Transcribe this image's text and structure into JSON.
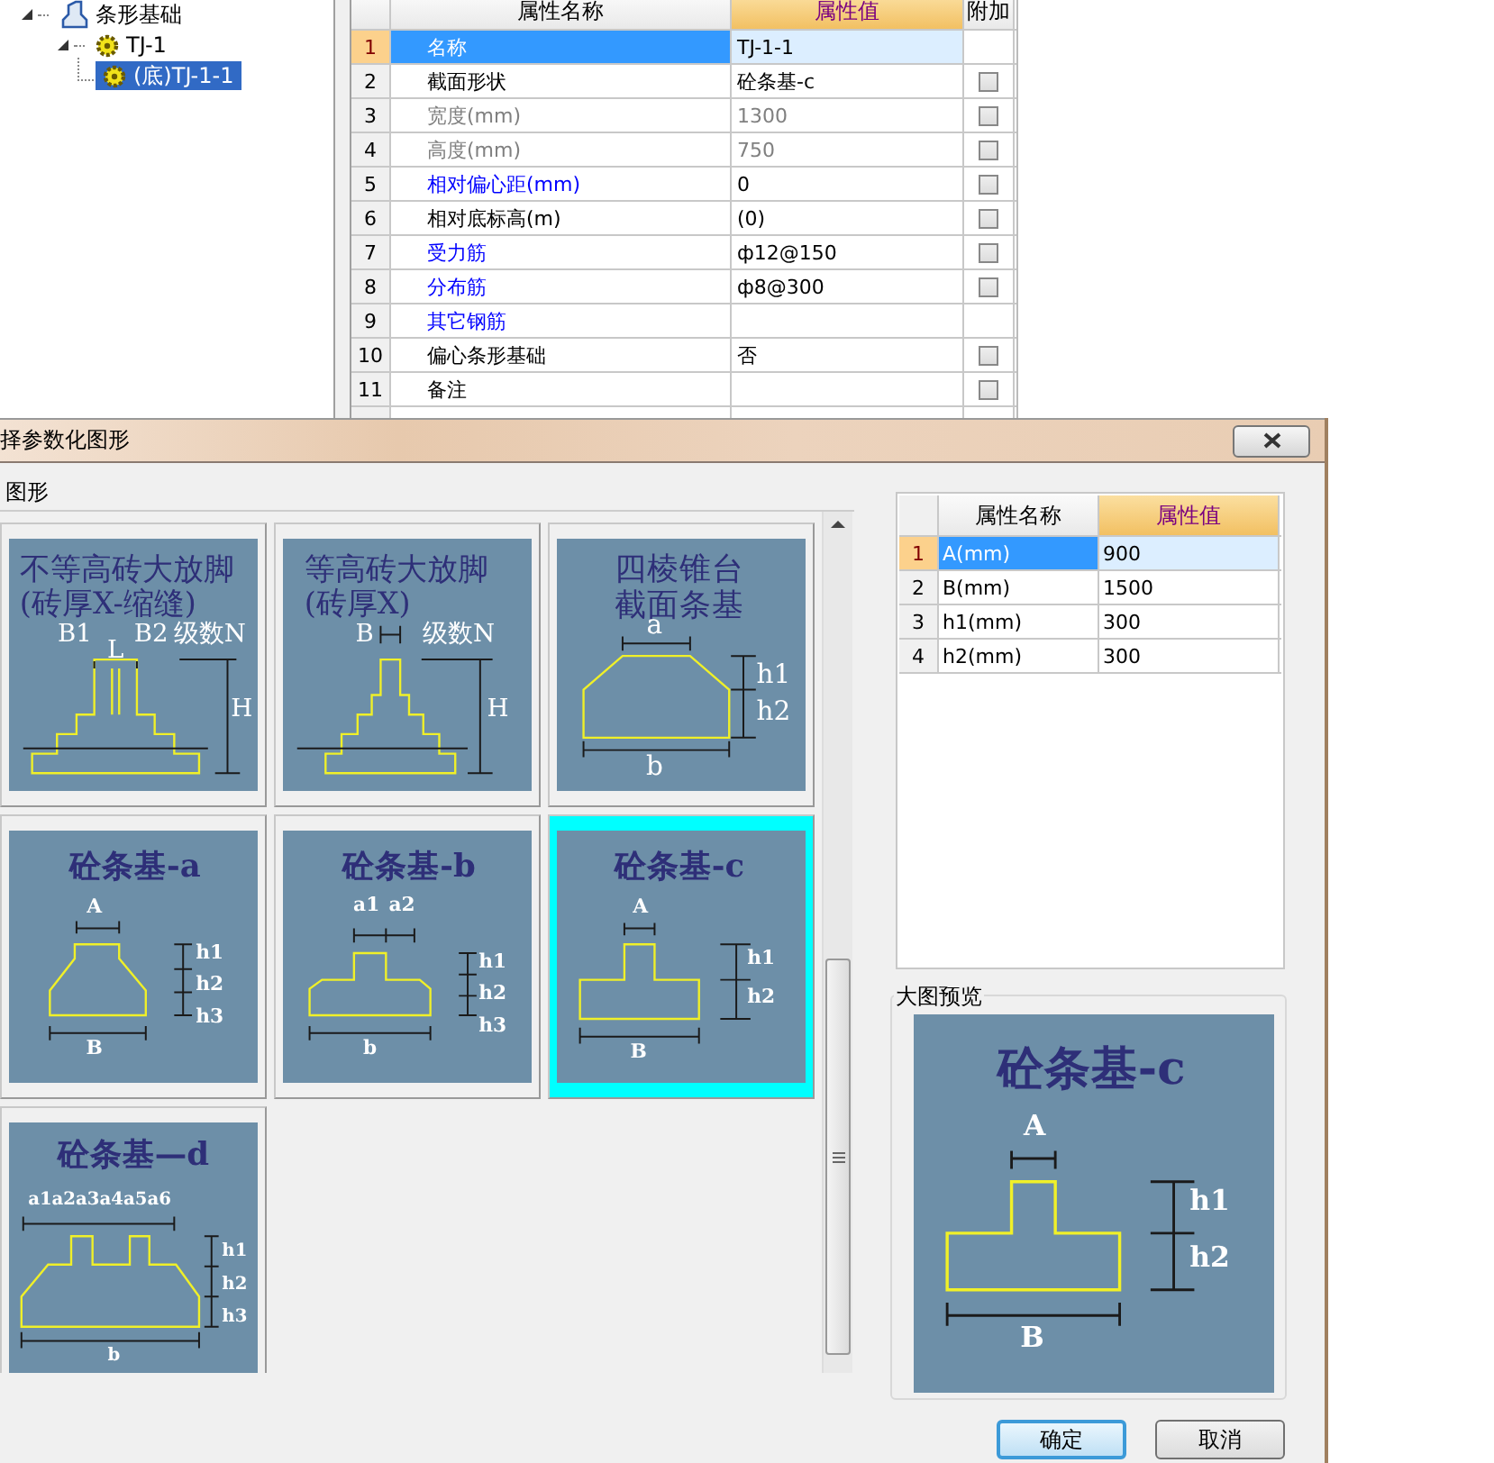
{
  "tree": {
    "label": "条形基础",
    "expanded": true,
    "selected": false,
    "children": [
      {
        "label": "TJ-1",
        "expanded": true,
        "selected": false,
        "children": [
          {
            "label": "(底)TJ-1-1",
            "selected": true
          }
        ]
      }
    ]
  },
  "properties": {
    "columns": [
      "属性名称",
      "属性值",
      "附加"
    ],
    "rows": [
      {
        "index": "1",
        "name": "名称",
        "value": "TJ-1-1",
        "kind": "normal",
        "selected": true,
        "has_checkbox": false
      },
      {
        "index": "2",
        "name": "截面形状",
        "value": "砼条基-c",
        "kind": "normal",
        "selected": false,
        "has_checkbox": true
      },
      {
        "index": "3",
        "name": "宽度(mm)",
        "value": "1300",
        "kind": "readonly",
        "selected": false,
        "has_checkbox": true
      },
      {
        "index": "4",
        "name": "高度(mm)",
        "value": "750",
        "kind": "readonly",
        "selected": false,
        "has_checkbox": true
      },
      {
        "index": "5",
        "name": "相对偏心距(mm)",
        "value": "0",
        "kind": "link",
        "selected": false,
        "has_checkbox": true
      },
      {
        "index": "6",
        "name": "相对底标高(m)",
        "value": "(0)",
        "kind": "normal",
        "selected": false,
        "has_checkbox": true
      },
      {
        "index": "7",
        "name": "受力筋",
        "value": "ф12@150",
        "kind": "link",
        "selected": false,
        "has_checkbox": true
      },
      {
        "index": "8",
        "name": "分布筋",
        "value": "ф8@300",
        "kind": "link",
        "selected": false,
        "has_checkbox": true
      },
      {
        "index": "9",
        "name": "其它钢筋",
        "value": "",
        "kind": "link",
        "selected": false,
        "has_checkbox": false
      },
      {
        "index": "10",
        "name": "偏心条形基础",
        "value": "否",
        "kind": "normal",
        "selected": false,
        "has_checkbox": true
      },
      {
        "index": "11",
        "name": "备注",
        "value": "",
        "kind": "normal",
        "selected": false,
        "has_checkbox": true
      }
    ]
  },
  "dialog": {
    "title": "择参数化图形",
    "shapes_group": "图形",
    "shapes": [
      {
        "kind": "brick_step_split",
        "title": [
          "不等高砖大放脚",
          "(砖厚X-缩缝)"
        ],
        "labels": [
          "B1",
          "L",
          "B2",
          "级数N",
          "H"
        ],
        "selected": false
      },
      {
        "kind": "brick_step",
        "title": [
          "等高砖大放脚",
          "(砖厚X)"
        ],
        "labels": [
          "B",
          "级数N",
          "H"
        ],
        "selected": false
      },
      {
        "kind": "frustum",
        "title": [
          "四棱锥台",
          "截面条基"
        ],
        "labels": [
          "a",
          "h1",
          "h2",
          "b"
        ],
        "selected": false
      },
      {
        "kind": "tee_slope",
        "title": [
          "砼条基-a"
        ],
        "labels": [
          "A",
          "h1",
          "h2",
          "h3",
          "B"
        ],
        "selected": false
      },
      {
        "kind": "tee_b",
        "title": [
          "砼条基-b"
        ],
        "labels": [
          "a1",
          "a2",
          "h1",
          "h2",
          "h3",
          "b"
        ],
        "selected": false
      },
      {
        "kind": "tee",
        "title": [
          "砼条基-c"
        ],
        "labels": [
          "A",
          "h1",
          "h2",
          "B"
        ],
        "selected": true
      },
      {
        "kind": "double_tee",
        "title": [
          "砼条基—d"
        ],
        "labels": [
          "a1a2a3a4a5a6",
          "h1",
          "h2",
          "h3",
          "b"
        ],
        "selected": false
      }
    ],
    "params": {
      "columns": [
        "属性名称",
        "属性值"
      ],
      "rows": [
        {
          "index": "1",
          "name": "A(mm)",
          "value": "900",
          "selected": true
        },
        {
          "index": "2",
          "name": "B(mm)",
          "value": "1500",
          "selected": false
        },
        {
          "index": "3",
          "name": "h1(mm)",
          "value": "300",
          "selected": false
        },
        {
          "index": "4",
          "name": "h2(mm)",
          "value": "300",
          "selected": false
        }
      ]
    },
    "preview_group": "大图预览",
    "preview": {
      "kind": "tee",
      "title": [
        "砼条基-c"
      ],
      "labels": [
        "A",
        "h1",
        "h2",
        "B"
      ]
    },
    "buttons": [
      {
        "label": "确定",
        "default": true
      },
      {
        "label": "取消",
        "default": false
      }
    ]
  }
}
